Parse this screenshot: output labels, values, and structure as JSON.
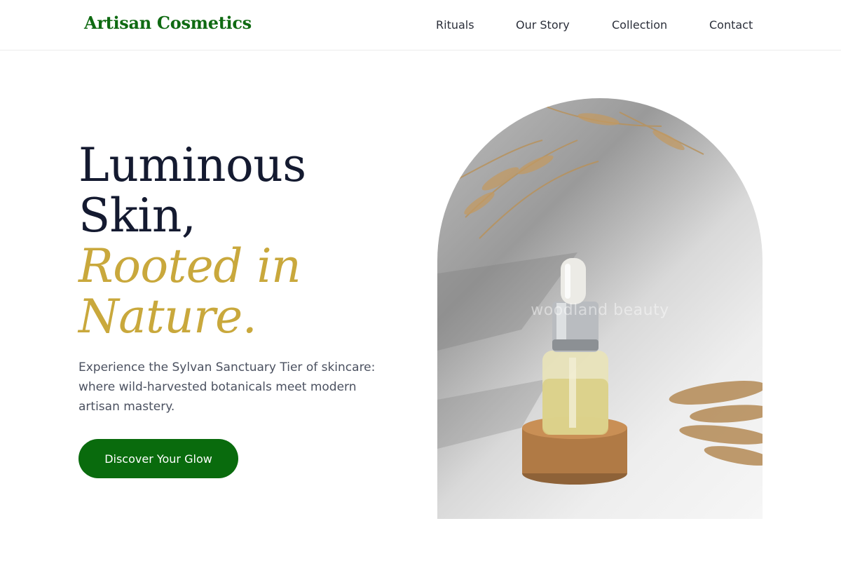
{
  "brand": {
    "name": "Artisan Cosmetics",
    "color": "#0f6a12"
  },
  "nav": {
    "items": [
      {
        "label": "Rituals"
      },
      {
        "label": "Our Story"
      },
      {
        "label": "Collection"
      },
      {
        "label": "Contact"
      }
    ]
  },
  "hero": {
    "title_line1": "Luminous",
    "title_line2": "Skin,",
    "accent_line1": "Rooted in",
    "accent_line2": "Nature.",
    "accent_color": "#c9a83c",
    "subtitle": "Experience the Sylvan Sanctuary Tier of skincare: where wild-harvested botanicals meet modern artisan mastery.",
    "cta_label": "Discover Your Glow",
    "cta_color": "#096b0d"
  },
  "image": {
    "subject": "serum-dropper-bottle-on-cork",
    "watermark": "woodland beauty"
  }
}
